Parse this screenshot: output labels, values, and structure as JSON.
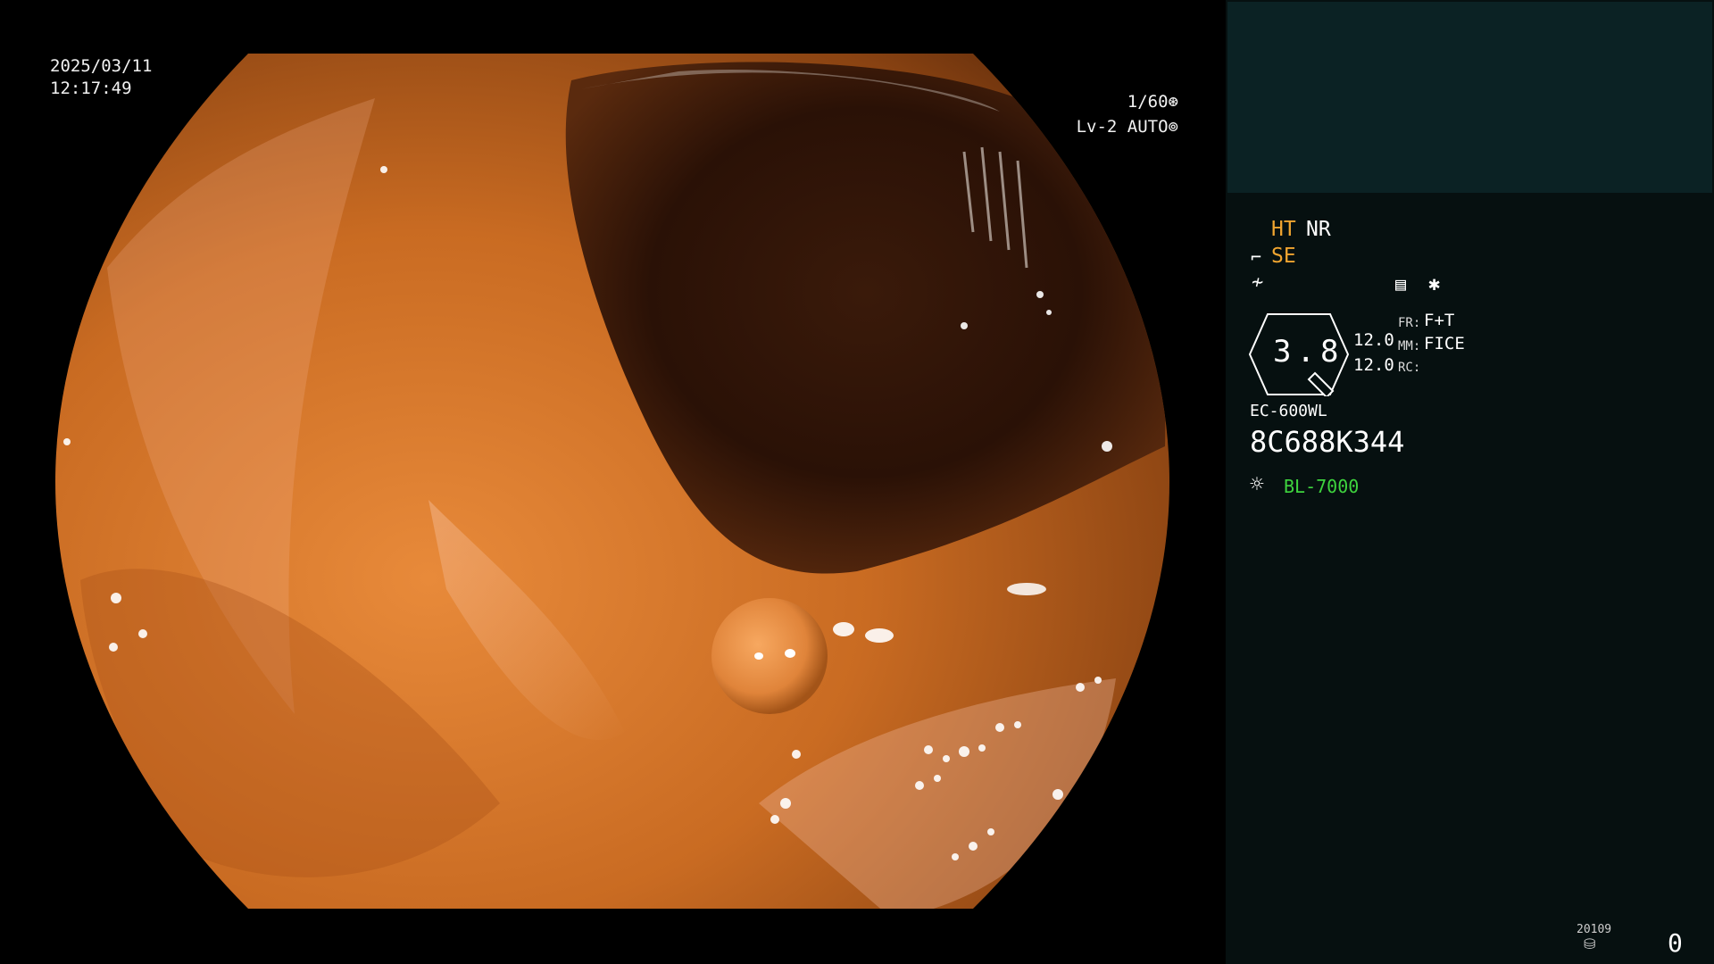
{
  "datetime": {
    "date": "2025/03/11",
    "time": "12:17:49"
  },
  "exposure": {
    "shutter": "1/60",
    "level": "Lv-2 AUTO"
  },
  "panel": {
    "ht": "HT",
    "nr": "NR",
    "se": "SE",
    "zoom": "3.8",
    "values": [
      "12.0",
      "12.0"
    ],
    "fr_label": "FR:",
    "fr_value": "F+T",
    "mm_label": "MM:",
    "mm_value": "FICE",
    "rc_label": "RC:",
    "scope_model": "EC-600WL",
    "serial": "8C688K344",
    "light_source": "BL-7000",
    "storage_label": "20109",
    "count": "0"
  },
  "colors": {
    "accent": "#f0a530",
    "light_source": "#3ed43e",
    "panel_bg": "#061010",
    "thumb_bg": "#0b2224"
  },
  "icons": [
    "aperture-icon",
    "iris-icon",
    "enhance-icon",
    "sharpness-icon",
    "menu-icon",
    "asterisk-icon",
    "lamp-icon",
    "disk-icon"
  ]
}
